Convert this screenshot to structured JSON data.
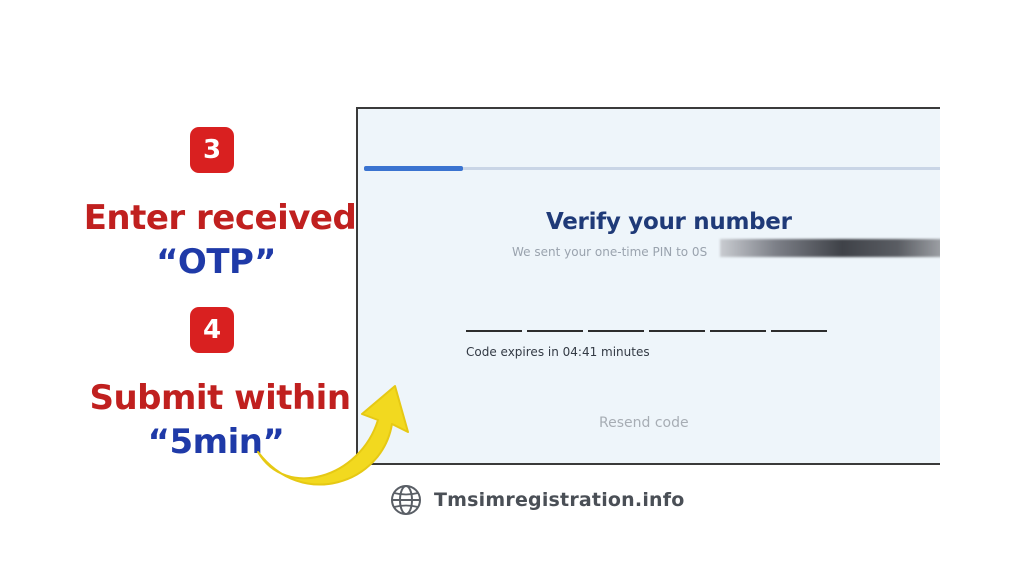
{
  "steps": [
    {
      "number": "3",
      "line1": "Enter received",
      "line2": "“OTP”"
    },
    {
      "number": "4",
      "line1": "Submit within",
      "line2": "“5min”"
    }
  ],
  "screen": {
    "progress": 0.17,
    "title": "Verify your number",
    "subtitle": "We sent your one-time PIN to 0S",
    "otp_digits": [
      "",
      "",
      "",
      "",
      "",
      ""
    ],
    "expiry": "Code expires in 04:41 minutes",
    "resend": "Resend code"
  },
  "footer": {
    "site": "Tmsimregistration.info",
    "icon": "globe-icon"
  },
  "colors": {
    "badge": "#d92020",
    "instruction_red": "#c0201f",
    "instruction_blue": "#1f3aa8",
    "arrow": "#f2d91f",
    "progress": "#3a73d0",
    "title": "#1f3a78"
  }
}
